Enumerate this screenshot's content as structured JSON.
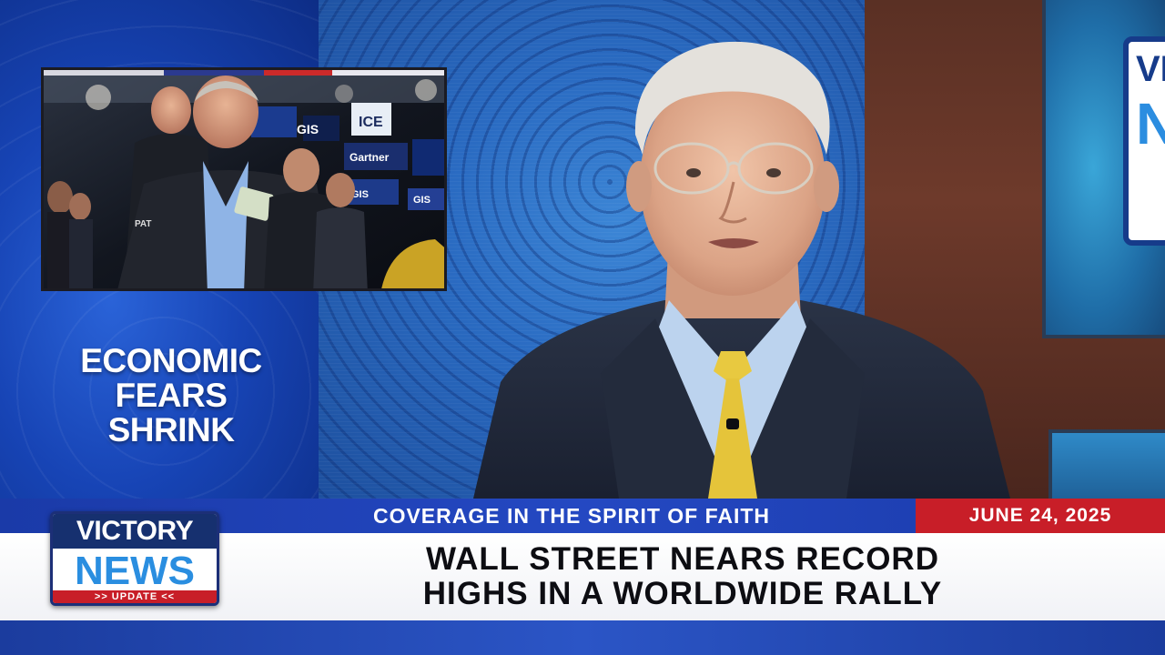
{
  "segment": {
    "headline_lines": [
      "ECONOMIC",
      "FEARS",
      "SHRINK"
    ]
  },
  "ticker": {
    "tagline": "COVERAGE IN THE SPIRIT OF FAITH",
    "date": "JUNE 24, 2025"
  },
  "story": {
    "title_lines": [
      "WALL STREET NEARS RECORD",
      "HIGHS IN A WORLDWIDE RALLY"
    ]
  },
  "logo": {
    "line1": "VICTORY",
    "line2": "NEWS",
    "line3": ">> UPDATE <<"
  },
  "background_screen": {
    "line1": "VICT",
    "line2": "N"
  },
  "inset_photo": {
    "badge_name": "PAT",
    "screen_labels": [
      "GIS",
      "ICE",
      "Gartner",
      "GIS",
      "GIS"
    ]
  },
  "colors": {
    "ticker_blue": "#2448c2",
    "date_red": "#c81e28",
    "logo_navy": "#16306f",
    "logo_blue": "#2a8ee0"
  }
}
